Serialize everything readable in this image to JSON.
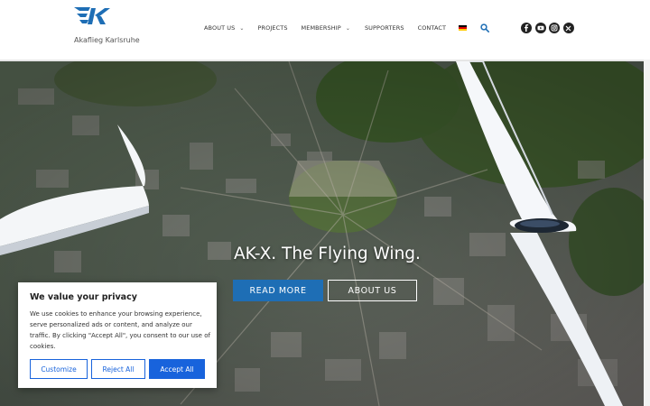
{
  "brand": {
    "caption": "Akaflieg Karlsruhe",
    "logo_icon": "akaflieg-ak-logo",
    "color": "#1e6eb5"
  },
  "nav": {
    "about": "ABOUT US",
    "projects": "PROJECTS",
    "membership": "MEMBERSHIP",
    "supporters": "SUPPORTERS",
    "contact": "CONTACT",
    "language_icon": "german-flag-icon",
    "search_icon": "search-icon"
  },
  "social": [
    "facebook-icon",
    "youtube-icon",
    "instagram-icon",
    "x-icon"
  ],
  "hero": {
    "title": "AK-X. The Flying Wing.",
    "primary_button": "READ MORE",
    "secondary_button": "ABOUT US",
    "primary_color": "#1e6eb5"
  },
  "cookie": {
    "title": "We value your privacy",
    "text": "We use cookies to enhance your browsing experience, serve personalized ads or content, and analyze our traffic. By clicking \"Accept All\", you consent to our use of cookies.",
    "customize": "Customize",
    "reject": "Reject All",
    "accept": "Accept All",
    "accent": "#1863dc"
  }
}
